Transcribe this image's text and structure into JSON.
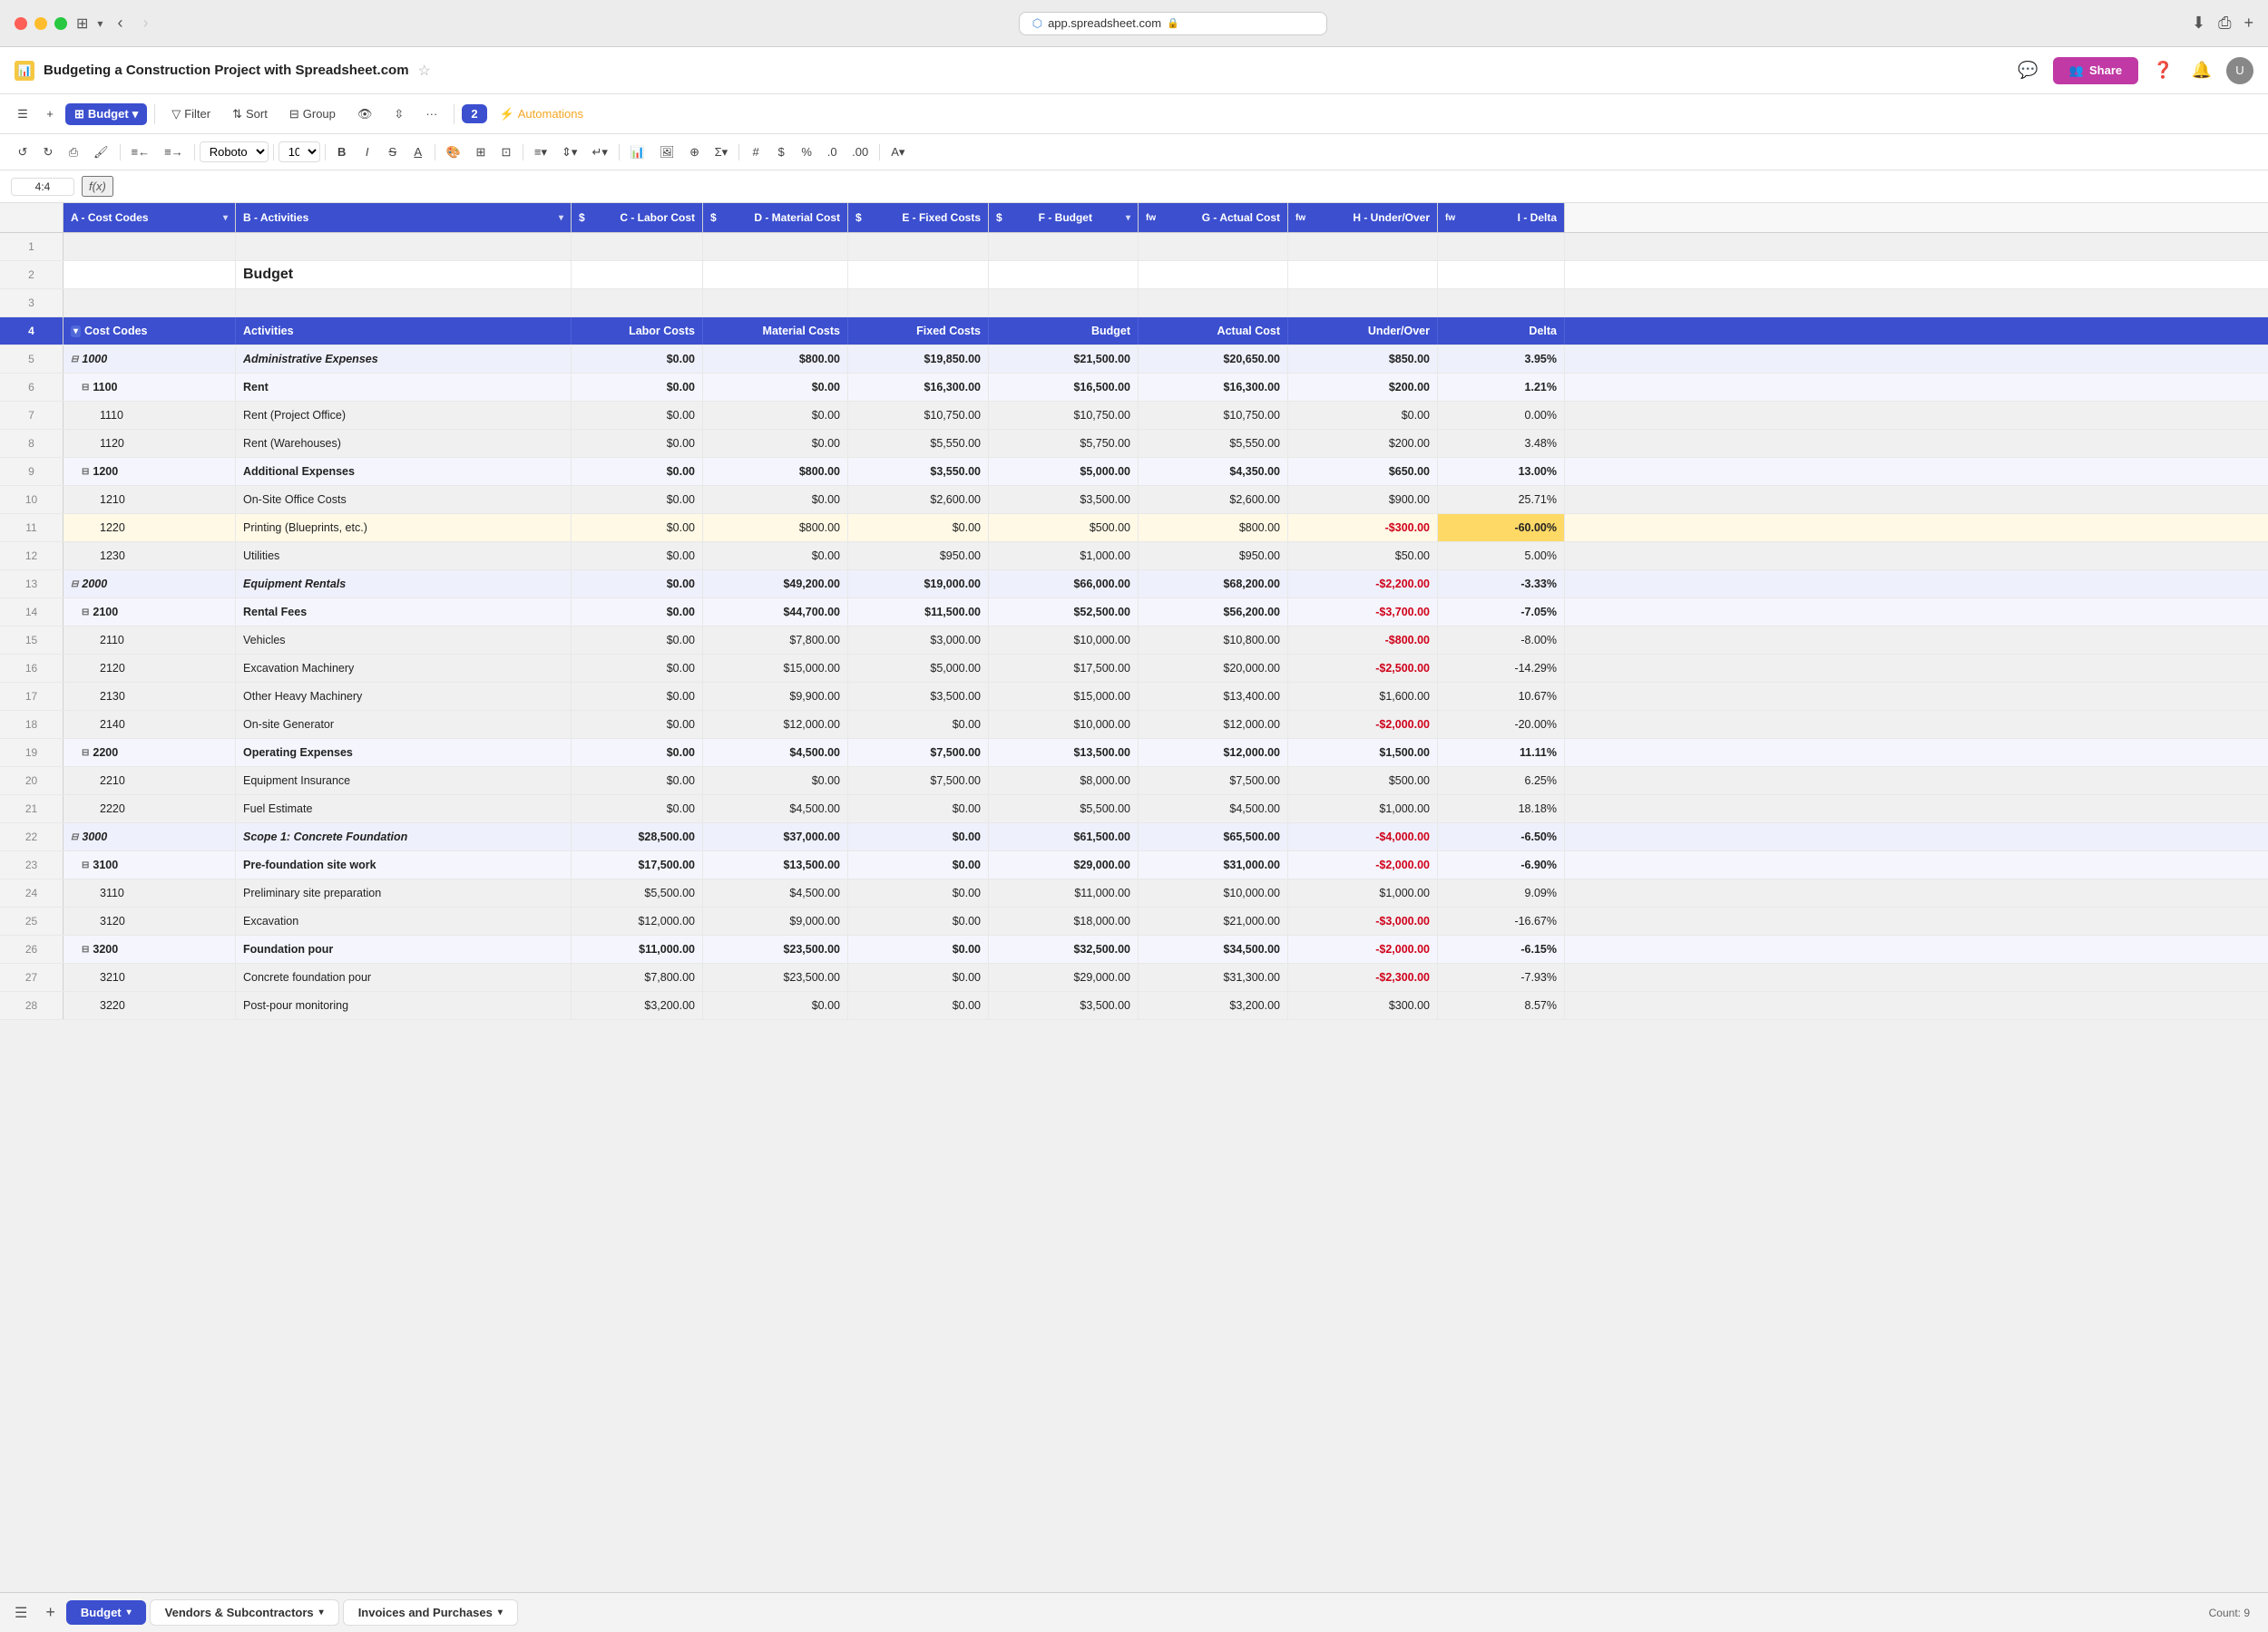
{
  "titlebar": {
    "url": "app.spreadsheet.com",
    "lock_icon": "🔒"
  },
  "app_header": {
    "doc_title": "Budgeting a Construction Project with Spreadsheet.com",
    "share_label": "Share",
    "share_icon": "👥"
  },
  "toolbar": {
    "hamburger": "☰",
    "plus": "+",
    "budget_label": "Budget",
    "filter_label": "Filter",
    "sort_label": "Sort",
    "group_label": "Group",
    "hide_label": "",
    "reorder_label": "",
    "more_label": "···",
    "views_count": "2",
    "automations_label": "Automations"
  },
  "format_toolbar": {
    "undo": "↺",
    "redo": "↻",
    "print": "⎙",
    "format_paint": "🖌",
    "align_left": "≡",
    "align_right": "≡",
    "font": "Roboto",
    "font_size": "10",
    "bold": "B",
    "italic": "I",
    "strike": "S",
    "underline": "A"
  },
  "formula_bar": {
    "cell_ref": "4:4",
    "fx_label": "f(x)"
  },
  "columns": {
    "a": {
      "label": "A - Cost Codes",
      "type": ""
    },
    "b": {
      "label": "B - Activities",
      "type": ""
    },
    "c": {
      "label": "C - Labor Cost",
      "type": "$"
    },
    "d": {
      "label": "D - Material Cost",
      "type": "$"
    },
    "e": {
      "label": "E - Fixed Costs",
      "type": "$"
    },
    "f": {
      "label": "F - Budget",
      "type": "$"
    },
    "g": {
      "label": "G - Actual Cost",
      "type": "fw"
    },
    "h": {
      "label": "H - Under/Over",
      "type": "fw"
    },
    "i": {
      "label": "I - Delta",
      "type": "fw"
    }
  },
  "header_row": {
    "cost_codes": "Cost Codes",
    "activities": "Activities",
    "labor_costs": "Labor Costs",
    "material_costs": "Material Costs",
    "fixed_costs": "Fixed Costs",
    "budget": "Budget",
    "actual_cost": "Actual Cost",
    "under_over": "Under/Over",
    "delta": "Delta"
  },
  "rows": [
    {
      "num": 1,
      "type": "empty"
    },
    {
      "num": 2,
      "type": "title",
      "b": "Budget"
    },
    {
      "num": 3,
      "type": "empty"
    },
    {
      "num": 4,
      "type": "header"
    },
    {
      "num": 5,
      "type": "l1",
      "a": "1000",
      "b": "Administrative Expenses",
      "c": "$0.00",
      "d": "$800.00",
      "e": "$19,850.00",
      "f": "$21,500.00",
      "g": "$20,650.00",
      "h": "$850.00",
      "i": "3.95%",
      "h_neg": false
    },
    {
      "num": 6,
      "type": "l2",
      "a": "1100",
      "b": "Rent",
      "c": "$0.00",
      "d": "$0.00",
      "e": "$16,300.00",
      "f": "$16,500.00",
      "g": "$16,300.00",
      "h": "$200.00",
      "i": "1.21%",
      "h_neg": false
    },
    {
      "num": 7,
      "type": "l3",
      "a": "1110",
      "b": "Rent (Project Office)",
      "c": "$0.00",
      "d": "$0.00",
      "e": "$10,750.00",
      "f": "$10,750.00",
      "g": "$10,750.00",
      "h": "$0.00",
      "i": "0.00%",
      "h_neg": false
    },
    {
      "num": 8,
      "type": "l3",
      "a": "1120",
      "b": "Rent (Warehouses)",
      "c": "$0.00",
      "d": "$0.00",
      "e": "$5,550.00",
      "f": "$5,750.00",
      "g": "$5,550.00",
      "h": "$200.00",
      "i": "3.48%",
      "h_neg": false
    },
    {
      "num": 9,
      "type": "l2",
      "a": "1200",
      "b": "Additional Expenses",
      "c": "$0.00",
      "d": "$800.00",
      "e": "$3,550.00",
      "f": "$5,000.00",
      "g": "$4,350.00",
      "h": "$650.00",
      "i": "13.00%",
      "h_neg": false
    },
    {
      "num": 10,
      "type": "l3",
      "a": "1210",
      "b": "On-Site Office Costs",
      "c": "$0.00",
      "d": "$0.00",
      "e": "$2,600.00",
      "f": "$3,500.00",
      "g": "$2,600.00",
      "h": "$900.00",
      "i": "25.71%",
      "h_neg": false
    },
    {
      "num": 11,
      "type": "l3",
      "a": "1220",
      "b": "Printing (Blueprints, etc.)",
      "c": "$0.00",
      "d": "$800.00",
      "e": "$0.00",
      "f": "$500.00",
      "g": "$800.00",
      "h": "-$300.00",
      "i": "-60.00%",
      "h_neg": true,
      "highlight_yellow": true
    },
    {
      "num": 12,
      "type": "l3",
      "a": "1230",
      "b": "Utilities",
      "c": "$0.00",
      "d": "$0.00",
      "e": "$950.00",
      "f": "$1,000.00",
      "g": "$950.00",
      "h": "$50.00",
      "i": "5.00%",
      "h_neg": false
    },
    {
      "num": 13,
      "type": "l1",
      "a": "2000",
      "b": "Equipment Rentals",
      "c": "$0.00",
      "d": "$49,200.00",
      "e": "$19,000.00",
      "f": "$66,000.00",
      "g": "$68,200.00",
      "h": "-$2,200.00",
      "i": "-3.33%",
      "h_neg": true
    },
    {
      "num": 14,
      "type": "l2",
      "a": "2100",
      "b": "Rental Fees",
      "c": "$0.00",
      "d": "$44,700.00",
      "e": "$11,500.00",
      "f": "$52,500.00",
      "g": "$56,200.00",
      "h": "-$3,700.00",
      "i": "-7.05%",
      "h_neg": true
    },
    {
      "num": 15,
      "type": "l3",
      "a": "2110",
      "b": "Vehicles",
      "c": "$0.00",
      "d": "$7,800.00",
      "e": "$3,000.00",
      "f": "$10,000.00",
      "g": "$10,800.00",
      "h": "-$800.00",
      "i": "-8.00%",
      "h_neg": true
    },
    {
      "num": 16,
      "type": "l3",
      "a": "2120",
      "b": "Excavation Machinery",
      "c": "$0.00",
      "d": "$15,000.00",
      "e": "$5,000.00",
      "f": "$17,500.00",
      "g": "$20,000.00",
      "h": "-$2,500.00",
      "i": "-14.29%",
      "h_neg": true
    },
    {
      "num": 17,
      "type": "l3",
      "a": "2130",
      "b": "Other Heavy Machinery",
      "c": "$0.00",
      "d": "$9,900.00",
      "e": "$3,500.00",
      "f": "$15,000.00",
      "g": "$13,400.00",
      "h": "$1,600.00",
      "i": "10.67%",
      "h_neg": false
    },
    {
      "num": 18,
      "type": "l3",
      "a": "2140",
      "b": "On-site Generator",
      "c": "$0.00",
      "d": "$12,000.00",
      "e": "$0.00",
      "f": "$10,000.00",
      "g": "$12,000.00",
      "h": "-$2,000.00",
      "i": "-20.00%",
      "h_neg": true
    },
    {
      "num": 19,
      "type": "l2",
      "a": "2200",
      "b": "Operating Expenses",
      "c": "$0.00",
      "d": "$4,500.00",
      "e": "$7,500.00",
      "f": "$13,500.00",
      "g": "$12,000.00",
      "h": "$1,500.00",
      "i": "11.11%",
      "h_neg": false
    },
    {
      "num": 20,
      "type": "l3",
      "a": "2210",
      "b": "Equipment Insurance",
      "c": "$0.00",
      "d": "$0.00",
      "e": "$7,500.00",
      "f": "$8,000.00",
      "g": "$7,500.00",
      "h": "$500.00",
      "i": "6.25%",
      "h_neg": false
    },
    {
      "num": 21,
      "type": "l3",
      "a": "2220",
      "b": "Fuel Estimate",
      "c": "$0.00",
      "d": "$4,500.00",
      "e": "$0.00",
      "f": "$5,500.00",
      "g": "$4,500.00",
      "h": "$1,000.00",
      "i": "18.18%",
      "h_neg": false
    },
    {
      "num": 22,
      "type": "l1",
      "a": "3000",
      "b": "Scope 1: Concrete Foundation",
      "c": "$28,500.00",
      "d": "$37,000.00",
      "e": "$0.00",
      "f": "$61,500.00",
      "g": "$65,500.00",
      "h": "-$4,000.00",
      "i": "-6.50%",
      "h_neg": true
    },
    {
      "num": 23,
      "type": "l2",
      "a": "3100",
      "b": "Pre-foundation site work",
      "c": "$17,500.00",
      "d": "$13,500.00",
      "e": "$0.00",
      "f": "$29,000.00",
      "g": "$31,000.00",
      "h": "-$2,000.00",
      "i": "-6.90%",
      "h_neg": true
    },
    {
      "num": 24,
      "type": "l3",
      "a": "3110",
      "b": "Preliminary site preparation",
      "c": "$5,500.00",
      "d": "$4,500.00",
      "e": "$0.00",
      "f": "$11,000.00",
      "g": "$10,000.00",
      "h": "$1,000.00",
      "i": "9.09%",
      "h_neg": false
    },
    {
      "num": 25,
      "type": "l3",
      "a": "3120",
      "b": "Excavation",
      "c": "$12,000.00",
      "d": "$9,000.00",
      "e": "$0.00",
      "f": "$18,000.00",
      "g": "$21,000.00",
      "h": "-$3,000.00",
      "i": "-16.67%",
      "h_neg": true
    },
    {
      "num": 26,
      "type": "l2",
      "a": "3200",
      "b": "Foundation pour",
      "c": "$11,000.00",
      "d": "$23,500.00",
      "e": "$0.00",
      "f": "$32,500.00",
      "g": "$34,500.00",
      "h": "-$2,000.00",
      "i": "-6.15%",
      "h_neg": true
    },
    {
      "num": 27,
      "type": "l3",
      "a": "3210",
      "b": "Concrete foundation pour",
      "c": "$7,800.00",
      "d": "$23,500.00",
      "e": "$0.00",
      "f": "$29,000.00",
      "g": "$31,300.00",
      "h": "-$2,300.00",
      "i": "-7.93%",
      "h_neg": true
    },
    {
      "num": 28,
      "type": "l3",
      "a": "3220",
      "b": "Post-pour monitoring",
      "c": "$3,200.00",
      "d": "$0.00",
      "e": "$0.00",
      "f": "$3,500.00",
      "g": "$3,200.00",
      "h": "$300.00",
      "i": "8.57%",
      "h_neg": false
    }
  ],
  "tabs": [
    {
      "label": "Budget",
      "active": true,
      "dropdown": true
    },
    {
      "label": "Vendors & Subcontractors",
      "active": false,
      "dropdown": true
    },
    {
      "label": "Invoices and Purchases",
      "active": false,
      "dropdown": true
    }
  ],
  "status": "Count: 9"
}
